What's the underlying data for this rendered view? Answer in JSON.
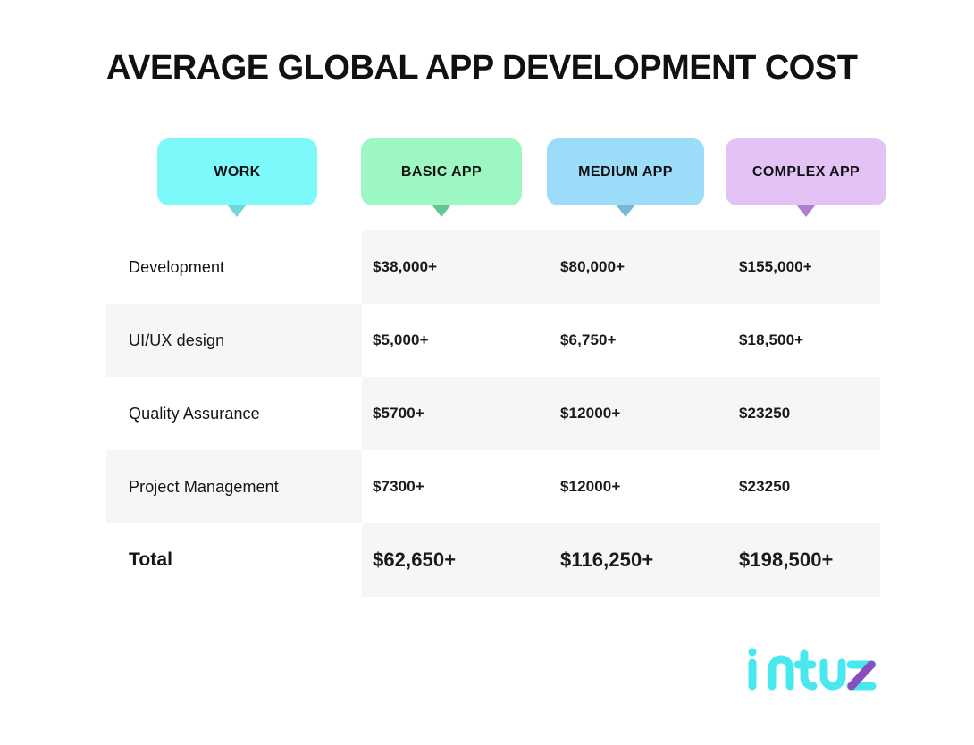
{
  "page": {
    "title": "AVERAGE GLOBAL APP DEVELOPMENT COST",
    "background_color": "#ffffff"
  },
  "table": {
    "columns": [
      {
        "label": "WORK",
        "pill_color": "#7df9fb",
        "pointer_color": "#6fd8dc",
        "name": "work"
      },
      {
        "label": "BASIC APP",
        "pill_color": "#9cf7c2",
        "pointer_color": "#63c792",
        "name": "basic-app"
      },
      {
        "label": "MEDIUM APP",
        "pill_color": "#9bdcf8",
        "pointer_color": "#77b7cf",
        "name": "medium-app"
      },
      {
        "label": "COMPLEX APP",
        "pill_color": "#e3c3f6",
        "pointer_color": "#ae7fd0",
        "name": "complex-app"
      }
    ],
    "shade_color": "#f6f6f6",
    "rows": [
      {
        "label": "Development",
        "values": [
          "$38,000+",
          "$80,000+",
          "$155,000+"
        ],
        "label_shaded": false,
        "values_shaded": true,
        "is_total": false
      },
      {
        "label": "UI/UX design",
        "values": [
          "$5,000+",
          "$6,750+",
          "$18,500+"
        ],
        "label_shaded": true,
        "values_shaded": false,
        "is_total": false
      },
      {
        "label": "Quality Assurance",
        "values": [
          "$5700+",
          "$12000+",
          "$23250"
        ],
        "label_shaded": false,
        "values_shaded": true,
        "is_total": false
      },
      {
        "label": "Project Management",
        "values": [
          "$7300+",
          "$12000+",
          "$23250"
        ],
        "label_shaded": true,
        "values_shaded": false,
        "is_total": false
      },
      {
        "label": "Total",
        "values": [
          "$62,650+",
          "$116,250+",
          "$198,500+"
        ],
        "label_shaded": false,
        "values_shaded": true,
        "is_total": true
      }
    ]
  },
  "logo": {
    "text": "intuz",
    "primary_color": "#49e8ef",
    "accent_color": "#8a4fbe"
  }
}
